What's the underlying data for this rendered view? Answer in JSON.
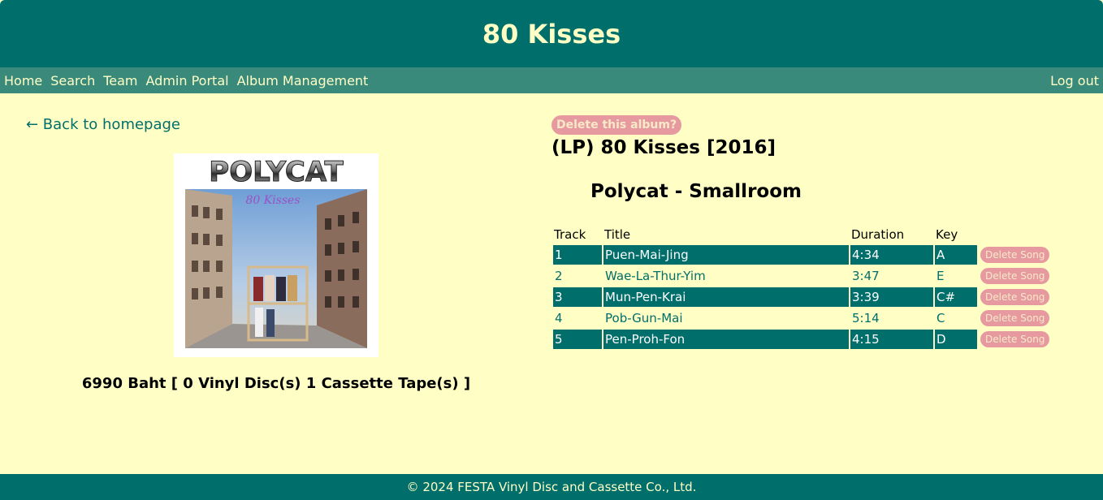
{
  "header": {
    "title": "80 Kisses"
  },
  "nav": {
    "items": [
      "Home",
      "Search",
      "Team",
      "Admin Portal",
      "Album Management"
    ],
    "logout": "Log out"
  },
  "left": {
    "back_link": "← Back to homepage",
    "cover": {
      "brand": "POLYCAT",
      "script_title": "80 Kisses"
    },
    "price_line": "6990 Baht [ 0 Vinyl Disc(s) 1 Cassette Tape(s) ]"
  },
  "right": {
    "delete_album_label": "Delete this album?",
    "album_title": "(LP) 80 Kisses [2016]",
    "artist_line": "Polycat - Smallroom",
    "table": {
      "headers": [
        "Track",
        "Title",
        "Duration",
        "Key"
      ],
      "delete_label": "Delete Song",
      "rows": [
        {
          "track": "1",
          "title": "Puen-Mai-Jing",
          "duration": "4:34",
          "key": "A"
        },
        {
          "track": "2",
          "title": "Wae-La-Thur-Yim",
          "duration": "3:47",
          "key": "E"
        },
        {
          "track": "3",
          "title": "Mun-Pen-Krai",
          "duration": "3:39",
          "key": "C#"
        },
        {
          "track": "4",
          "title": "Pob-Gun-Mai",
          "duration": "5:14",
          "key": "C"
        },
        {
          "track": "5",
          "title": "Pen-Proh-Fon",
          "duration": "4:15",
          "key": "D"
        }
      ]
    }
  },
  "footer": {
    "text": "© 2024 FESTA Vinyl Disc and Cassette Co., Ltd."
  },
  "colors": {
    "primary": "#006f6b",
    "nav": "#3a8a7c",
    "background": "#ffffc5",
    "delete_button": "#e69aa0"
  }
}
